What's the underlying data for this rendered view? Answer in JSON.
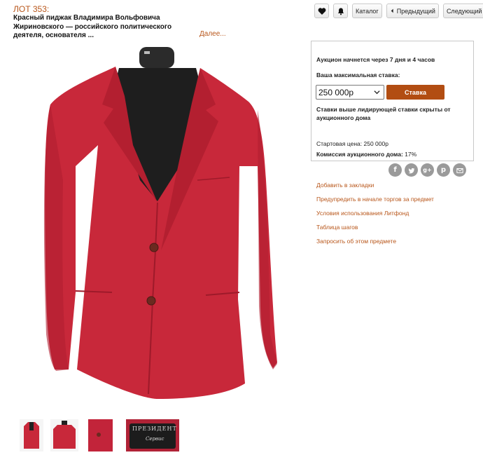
{
  "lot": {
    "number": "ЛОТ 353:",
    "title": "Красный пиджак Владимира Вольфовича Жириновского — российского политического деятеля, основателя ...",
    "more": "Далее..."
  },
  "toolbar": {
    "catalog": "Каталог",
    "prev": "Предыдущий",
    "next": "Следующий"
  },
  "bid": {
    "starts_in": "Аукцион начнется через 7 дня и 4 часов",
    "max_label": "Ваша максимальная ставка:",
    "selected_amount": "250 000р",
    "button": "Ставка",
    "hidden_note": "Ставки выше лидирующей ставки скрыты от аукционного дома",
    "start_price": "Стартовая цена: 250 000р",
    "commission_label": "Комиссия аукционного дома:",
    "commission_value": "17%"
  },
  "share": [
    "facebook-icon",
    "twitter-icon",
    "google-plus-icon",
    "pinterest-icon",
    "email-icon"
  ],
  "links": [
    "Добавить в закладки",
    "Предупредить в начале торгов за предмет",
    "Условия использования Литфонд",
    "Таблица шагов",
    "Запросить об этом предмете"
  ],
  "thumbnail_label": {
    "brand_line1": "ПРЕЗИДЕНТ",
    "brand_line2": "Сервис"
  },
  "colors": {
    "accent": "#b8561a",
    "bid_button": "#b24d12",
    "jacket": "#c8283a"
  }
}
